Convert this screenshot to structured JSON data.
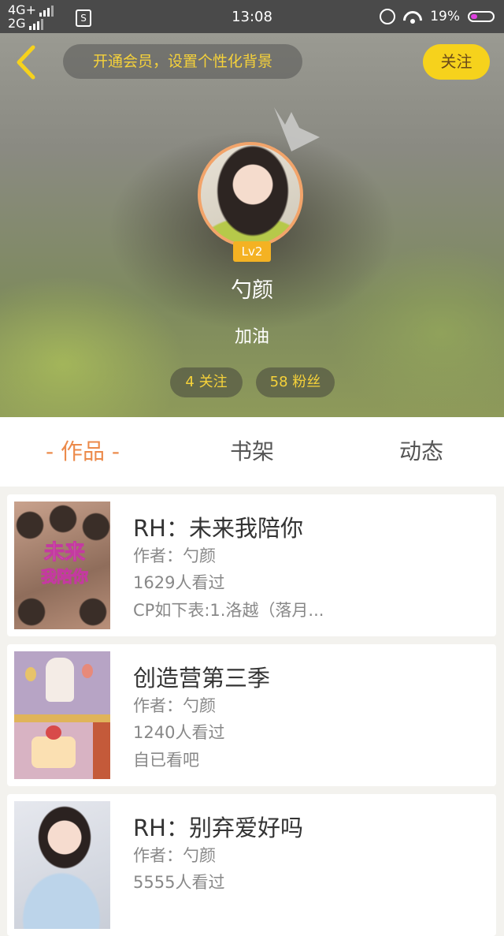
{
  "status_bar": {
    "network_top": "4G+",
    "network_bottom": "2G",
    "sim_label": "S",
    "time": "13:08",
    "battery": "19%"
  },
  "header": {
    "vip_promo": "开通会员，设置个性化背景",
    "follow_label": "关注",
    "level": "Lv2",
    "name": "勺颜",
    "bio": "加油",
    "following": "4 关注",
    "fans": "58 粉丝"
  },
  "tabs": [
    {
      "label": "- 作品 -"
    },
    {
      "label": "书架"
    },
    {
      "label": "动态"
    }
  ],
  "books": [
    {
      "title": "RH：未来我陪你",
      "author": "作者：勺颜",
      "views": "1629人看过",
      "desc": "CP如下表:1.洛越（落月...",
      "cover_text_1": "未来",
      "cover_text_2": "我陪你"
    },
    {
      "title": "创造营第三季",
      "author": "作者：勺颜",
      "views": "1240人看过",
      "desc": "自已看吧"
    },
    {
      "title": "RH：别弃爱好吗",
      "author": "作者：勺颜",
      "views": "5555人看过",
      "desc": ""
    }
  ],
  "colors": {
    "accent_orange": "#ec8a4a",
    "vip_yellow": "#f6d23a",
    "follow_bg": "#f6d21c"
  }
}
